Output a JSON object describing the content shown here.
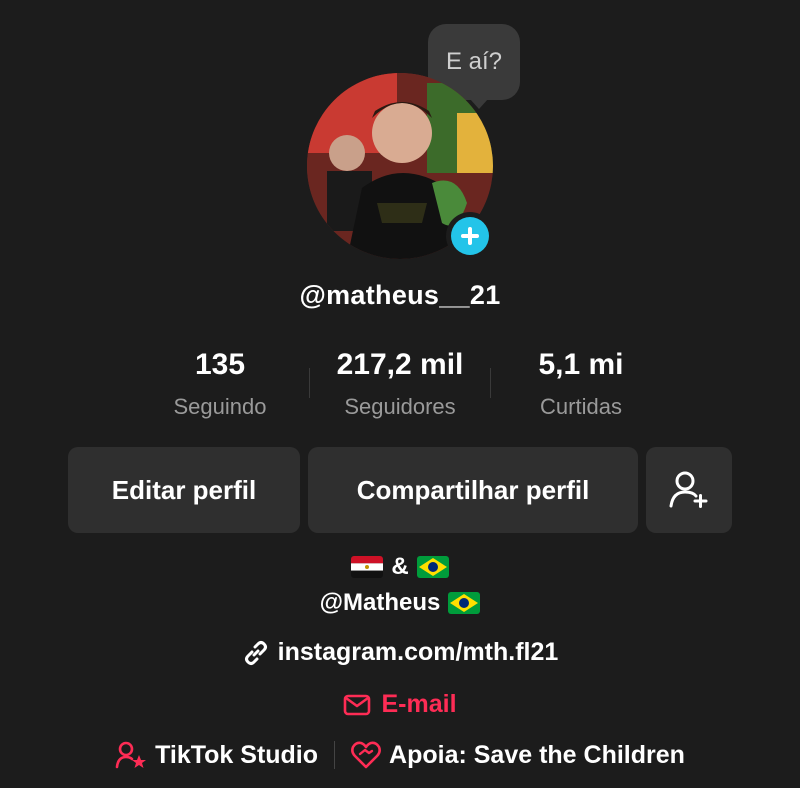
{
  "bubble": {
    "text": "E aí?"
  },
  "profile": {
    "username": "@matheus__21"
  },
  "stats": [
    {
      "value": "135",
      "label": "Seguindo"
    },
    {
      "value": "217,2 mil",
      "label": "Seguidores"
    },
    {
      "value": "5,1 mi",
      "label": "Curtidas"
    }
  ],
  "actions": {
    "edit_label": "Editar perfil",
    "share_label": "Compartilhar perfil"
  },
  "bio": {
    "line1_amp": "&",
    "line2_handle": "@Matheus"
  },
  "link": {
    "text": "instagram.com/mth.fl21"
  },
  "email": {
    "label": "E-mail"
  },
  "studio": {
    "label": "TikTok Studio"
  },
  "charity": {
    "label": "Apoia: Save the Children"
  },
  "colors": {
    "accent": "#fe2c55",
    "add_badge": "#23c4e9",
    "background": "#1c1c1c",
    "button_bg": "#2f2f2f"
  }
}
